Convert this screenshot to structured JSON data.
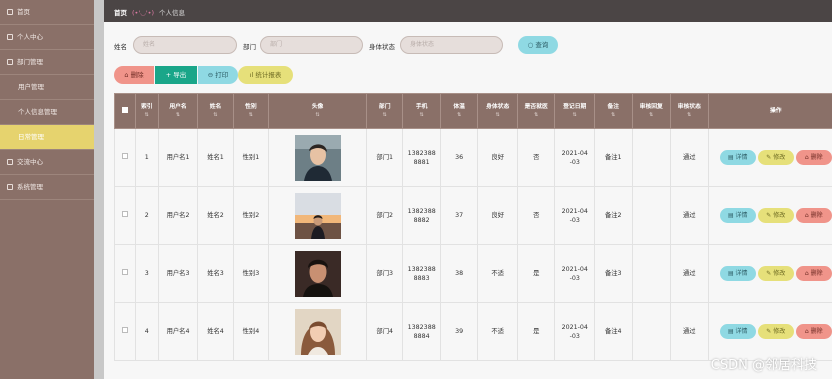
{
  "sidebar": {
    "items": [
      {
        "label": "首页",
        "sub": false
      },
      {
        "label": "个人中心",
        "sub": false
      },
      {
        "label": "部门管理",
        "sub": false
      },
      {
        "label": "用户管理",
        "sub": true
      },
      {
        "label": "个人信息管理",
        "sub": true
      },
      {
        "label": "日常管理",
        "sub": true,
        "active": true
      },
      {
        "label": "交流中心",
        "sub": false
      },
      {
        "label": "系统管理",
        "sub": false
      }
    ]
  },
  "breadcrumb": {
    "home": "首页",
    "emoticon": "(•'◡'•)",
    "current": "个人信息"
  },
  "search": {
    "name_label": "姓名",
    "name_placeholder": "姓名",
    "dept_label": "部门",
    "dept_placeholder": "部门",
    "status_label": "身体状态",
    "status_placeholder": "身体状态",
    "query_label": "查询"
  },
  "actions": {
    "delete": "删除",
    "export": "导出",
    "print": "打印",
    "report": "统计报表"
  },
  "table": {
    "headers": [
      "索引",
      "用户名",
      "姓名",
      "性别",
      "头像",
      "部门",
      "手机",
      "体温",
      "身体状态",
      "是否就医",
      "登记日期",
      "备注",
      "审核回复",
      "审核状态",
      "操作"
    ],
    "rows": [
      {
        "index": "1",
        "username": "用户名1",
        "name": "姓名1",
        "gender": "性别1",
        "avatar": "avatar-1",
        "dept": "部门1",
        "phone_a": "1382388",
        "phone_b": "8881",
        "temp": "36",
        "status": "良好",
        "doctor": "否",
        "date_a": "2021-04",
        "date_b": "-03",
        "note": "备注1",
        "reply": "",
        "audit": "通过"
      },
      {
        "index": "2",
        "username": "用户名2",
        "name": "姓名2",
        "gender": "性别2",
        "avatar": "avatar-2",
        "dept": "部门2",
        "phone_a": "1382388",
        "phone_b": "8882",
        "temp": "37",
        "status": "良好",
        "doctor": "否",
        "date_a": "2021-04",
        "date_b": "-03",
        "note": "备注2",
        "reply": "",
        "audit": "通过"
      },
      {
        "index": "3",
        "username": "用户名3",
        "name": "姓名3",
        "gender": "性别3",
        "avatar": "avatar-3",
        "dept": "部门3",
        "phone_a": "1382388",
        "phone_b": "8883",
        "temp": "38",
        "status": "不适",
        "doctor": "是",
        "date_a": "2021-04",
        "date_b": "-03",
        "note": "备注3",
        "reply": "",
        "audit": "通过"
      },
      {
        "index": "4",
        "username": "用户名4",
        "name": "姓名4",
        "gender": "性别4",
        "avatar": "avatar-4",
        "dept": "部门4",
        "phone_a": "1382388",
        "phone_b": "8884",
        "temp": "39",
        "status": "不适",
        "doctor": "是",
        "date_a": "2021-04",
        "date_b": "-03",
        "note": "备注4",
        "reply": "",
        "audit": "通过"
      }
    ],
    "ops": {
      "detail": "详情",
      "edit": "修改",
      "delete": "删除"
    }
  },
  "watermark": "CSDN @邻居科技"
}
